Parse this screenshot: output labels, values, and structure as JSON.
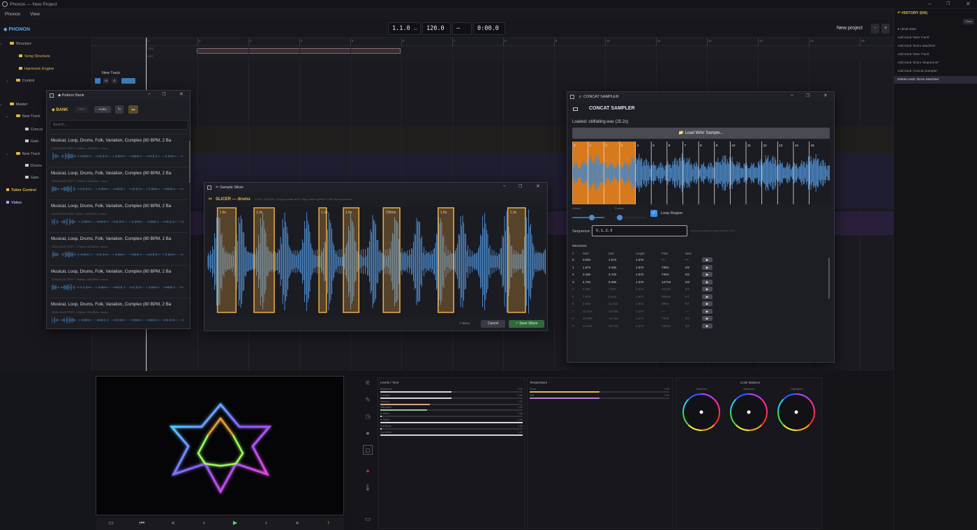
{
  "app": {
    "title": "Phonon — New Project",
    "menu": [
      "Phonon",
      "View"
    ],
    "brand": "◆ PHONON",
    "new_project": "New project",
    "minus": "-",
    "plus": "+"
  },
  "transport_readouts": [
    {
      "value": "1.1.0",
      "unit": "bar"
    },
    {
      "value": "120.0",
      "unit": "bpm"
    },
    {
      "value": "—",
      "unit": "(beat)"
    },
    {
      "value": "0:00.0",
      "unit": "time"
    }
  ],
  "history": {
    "title": "↶ HISTORY (6/6)",
    "clear": "Clear",
    "items": [
      "● Initial state",
      "Add track 'New Track'",
      "Add track 'Drum Machine'",
      "Add track 'New Track'",
      "Add track 'Drum Sequencer'",
      "Add track 'Concat Sampler'",
      "Delete track 'Drum Machine'"
    ],
    "selected": 6
  },
  "tree": [
    {
      "label": "Structure",
      "kind": "folder",
      "indent": 1
    },
    {
      "label": "Song Structure",
      "kind": "item",
      "indent": 3,
      "accent": "#e6b84a"
    },
    {
      "label": "Harmonic Engine",
      "kind": "item",
      "indent": 3,
      "accent": "#e6b84a"
    },
    {
      "label": "Control",
      "kind": "folder",
      "indent": 2
    },
    {
      "label": "Master",
      "kind": "folder",
      "indent": 1
    },
    {
      "label": "New Track",
      "kind": "folder",
      "indent": 2
    },
    {
      "label": "Concat",
      "kind": "item",
      "indent": 4
    },
    {
      "label": "Gain",
      "kind": "item",
      "indent": 4
    },
    {
      "label": "New Track",
      "kind": "folder",
      "indent": 2
    },
    {
      "label": "Drums",
      "kind": "item",
      "indent": 4
    },
    {
      "label": "Gain",
      "kind": "item",
      "indent": 4
    },
    {
      "label": "Tuber Control",
      "kind": "bold",
      "indent": 1,
      "accent": "#e6b84a"
    },
    {
      "label": "Video",
      "kind": "bold",
      "indent": 1,
      "accent": "#b9a5ff"
    }
  ],
  "ruler_numbers": [
    "1",
    "2",
    "3",
    "4",
    "5",
    "6",
    "7",
    "8",
    "9",
    "10",
    "11",
    "12",
    "13",
    "14",
    "15"
  ],
  "track_header": {
    "name": "New Track",
    "buttons": [
      "M",
      "S"
    ]
  },
  "lane_labels": [
    "START",
    "BARS"
  ],
  "pattern_bank": {
    "title": "◆ Pattern Bank",
    "tab": "◆ BANK",
    "midi": "MIDI",
    "audio": "Audio",
    "search_placeholder": "Search...",
    "items": [
      {
        "title": "Musical, Loop, Drums, Folk, Variation, Complex (80 BPM, 2 Ba",
        "meta": "2026-06-25 TRST • 146ms • 44100Hz • mono"
      },
      {
        "title": "Musical, Loop, Drums, Folk, Variation, Complex (80 BPM, 2 Ba",
        "meta": "2026-06-25 TRST • 120ms • 44100Hz • mono"
      },
      {
        "title": "Musical, Loop, Drums, Folk, Variation, Complex (80 BPM, 2 Ba",
        "meta": "2026-06-25 TRST • 87ms • 44100Hz • mono"
      },
      {
        "title": "Musical, Loop, Drums, Folk, Variation, Complex (80 BPM, 2 Ba",
        "meta": "2026-06-25 TRST • 270ms • 44100Hz • mono"
      },
      {
        "title": "Musical, Loop, Drums, Folk, Variation, Complex (80 BPM, 2 Ba",
        "meta": "2026-06-25 TRST • 395ms • 44100Hz • mono"
      },
      {
        "title": "Musical, Loop, Drums, Folk, Variation, Complex (80 BPM, 2 Ba",
        "meta": "2026-06-25 TRST • 120ms • 44100Hz • mono"
      }
    ]
  },
  "slicer": {
    "title": "✂ Sample Slicer",
    "header": "SLICER — drums",
    "info": "12.6s • 44100Hz • Drag to create slice • Right-click to delete • Click slice to preview",
    "count": "7 slices",
    "cancel": "Cancel",
    "save": "✓ Save Slices",
    "slices": [
      {
        "start": 0.03,
        "end": 0.085,
        "label": "1.6s"
      },
      {
        "start": 0.138,
        "end": 0.198,
        "label": "1.3s"
      },
      {
        "start": 0.33,
        "end": 0.352,
        "label": "1.3s"
      },
      {
        "start": 0.402,
        "end": 0.448,
        "label": "1.6s"
      },
      {
        "start": 0.52,
        "end": 0.569,
        "label": "730ms"
      },
      {
        "start": 0.682,
        "end": 0.728,
        "label": "1.5s"
      },
      {
        "start": 0.888,
        "end": 0.94,
        "label": "1.3s"
      }
    ]
  },
  "sampler": {
    "title": "♬ CONCAT SAMPLER",
    "header": "CONCAT SAMPLER",
    "loaded": "Loaded: stillfalling.wav (25.2s)",
    "load_button": "📁 Load WAV Sample...",
    "marker_labels": [
      "0",
      "1",
      "2",
      "3",
      "4",
      "5",
      "6",
      "7",
      "8",
      "9",
      "10",
      "11",
      "12",
      "13",
      "14",
      "15"
    ],
    "volume_label": "Volume",
    "release_label": "Release",
    "volume_value": 0.6,
    "release_value": 0.15,
    "loop_label": "Loop Region",
    "loop": true,
    "sequence_label": "Sequence:",
    "sequence_value": "0, 1, 2, 3",
    "sequence_hint": "comma-separated region indices 0-15",
    "regions_title": "REGIONS",
    "columns": [
      "#",
      "Start",
      "End",
      "Length",
      "Pitch",
      "Note"
    ],
    "rows": [
      [
        "0",
        "0.00s",
        "1.57s",
        "1.57s",
        "—",
        "—"
      ],
      [
        "1",
        "1.57s",
        "3.15s",
        "1.57s",
        "73Hz",
        "D2"
      ],
      [
        "2",
        "3.15s",
        "4.72s",
        "1.57s",
        "74Hz",
        "D2"
      ],
      [
        "3",
        "4.72s",
        "6.29s",
        "1.57s",
        "147Hz",
        "D3"
      ],
      [
        "4",
        "6.29s",
        "7.87s",
        "1.57s",
        "161Hz",
        "E3"
      ],
      [
        "5",
        "7.87s",
        "9.44s",
        "1.57s",
        "368Hz",
        "F4"
      ],
      [
        "6",
        "9.44s",
        "11.01s",
        "1.57s",
        "88Hz",
        "F2"
      ],
      [
        "7",
        "11.01s",
        "12.59s",
        "1.57s",
        "—",
        "—"
      ],
      [
        "8",
        "12.59s",
        "14.16s",
        "1.57s",
        "74Hz",
        "D2"
      ],
      [
        "9",
        "14.16s",
        "15.73s",
        "1.57s",
        "148Hz",
        "D3"
      ]
    ],
    "play": "▶",
    "active_regions": 4
  },
  "levels": {
    "title": "Levels / Tone",
    "items": [
      {
        "label": "Brightness",
        "value": "0.00",
        "fill": 0.5,
        "color": "#d6d6d6"
      },
      {
        "label": "Contrast",
        "value": "1.00",
        "fill": 0.5,
        "color": "#d6d6d6"
      },
      {
        "label": "Gamma",
        "value": "1.00",
        "fill": 0.35,
        "color": "#d8a582"
      },
      {
        "label": "Saturation",
        "value": "1.00",
        "fill": 0.33,
        "color": "#8fc7a0"
      },
      {
        "label": "In Black",
        "value": "0.00",
        "fill": 0.01,
        "color": "#d6d6d6"
      },
      {
        "label": "In White",
        "value": "1.00",
        "fill": 1.0,
        "color": "#d6d6d6"
      },
      {
        "label": "Out Black",
        "value": "0.00",
        "fill": 0.01,
        "color": "#d6d6d6"
      },
      {
        "label": "Out White",
        "value": "1.00",
        "fill": 1.0,
        "color": "#d6d6d6"
      }
    ]
  },
  "temperature": {
    "title": "Temperature",
    "items": [
      {
        "label": "Temp",
        "value": "0.00",
        "fill": 0.5,
        "color": "#e6b84a"
      },
      {
        "label": "Tint",
        "value": "0.00",
        "fill": 0.5,
        "color": "#c07cd9"
      }
    ]
  },
  "color_balance": {
    "title": "Color Balance",
    "wheels": [
      "Shadows",
      "Midtones",
      "Highlights"
    ]
  },
  "transport_buttons": [
    "▭",
    "⏮",
    "«",
    "‹",
    "▶",
    "›",
    "»",
    "↑"
  ],
  "colors": {
    "accent": "#e6b84a",
    "blue": "#4d8fd0",
    "orange": "#d77a1e"
  }
}
